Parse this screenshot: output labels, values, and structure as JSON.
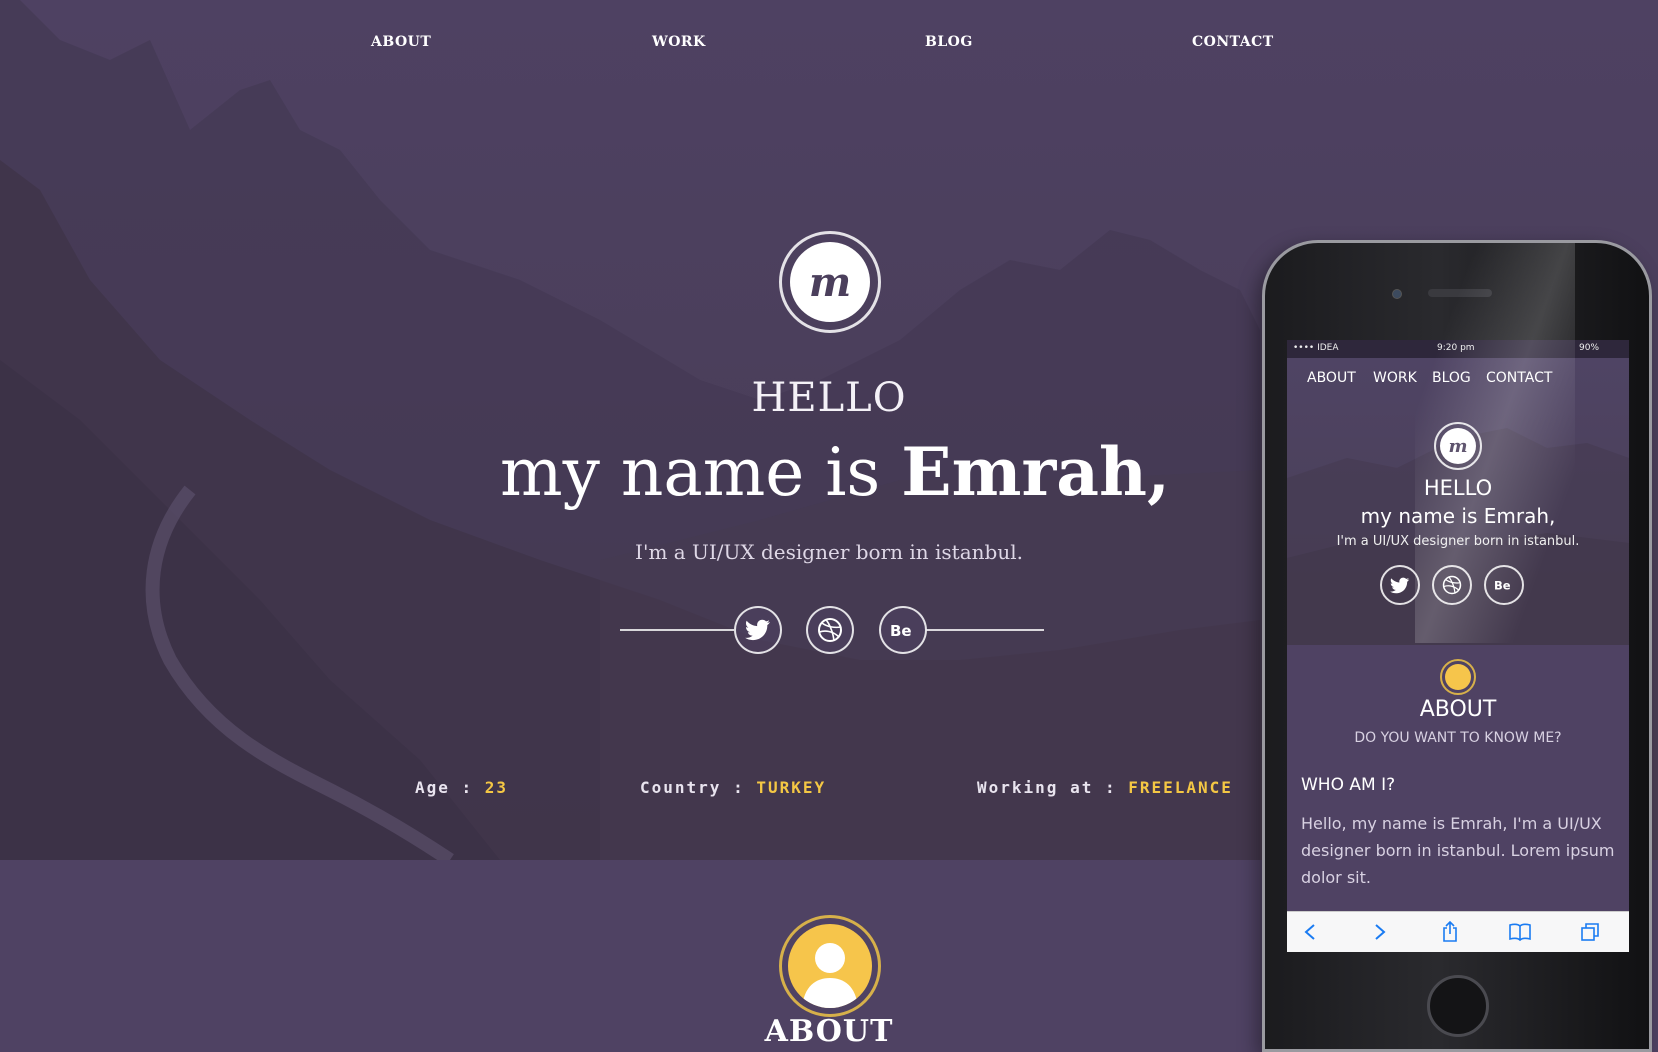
{
  "nav": {
    "items": [
      {
        "label": "ABOUT"
      },
      {
        "label": "WORK"
      },
      {
        "label": "BLOG"
      },
      {
        "label": "CONTACT"
      }
    ]
  },
  "hero": {
    "logo_letter": "m",
    "greeting": "HELLO",
    "name_prefix": "my name is ",
    "name": "Emrah,",
    "tagline": "I'm a UI/UX designer born in istanbul.",
    "social": [
      {
        "icon": "twitter-icon"
      },
      {
        "icon": "dribbble-icon"
      },
      {
        "icon": "behance-icon"
      }
    ],
    "facts": [
      {
        "label": "Age : ",
        "value": "23"
      },
      {
        "label": "Country : ",
        "value": "TURKEY"
      },
      {
        "label": "Working at : ",
        "value": "FREELANCE"
      }
    ]
  },
  "about": {
    "title": "ABOUT",
    "icon": "user-avatar-icon"
  },
  "mobile": {
    "status": {
      "carrier": "•••• IDEA",
      "time": "9:20 pm",
      "battery": "90%"
    },
    "nav": [
      {
        "label": "ABOUT"
      },
      {
        "label": "WORK"
      },
      {
        "label": "BLOG"
      },
      {
        "label": "CONTACT"
      }
    ],
    "logo_letter": "m",
    "greeting": "HELLO",
    "name_line": "my name is Emrah,",
    "tagline": "I'm a UI/UX designer born in istanbul.",
    "about_title": "ABOUT",
    "about_subtitle": "DO YOU WANT TO KNOW ME?",
    "who_title": "WHO AM I?",
    "body": "Hello, my name is Emrah, I'm a UI/UX designer born in istanbul. Lorem ipsum dolor sit."
  },
  "colors": {
    "background": "#4f4263",
    "accent": "#f4c744",
    "avatar": "#f6c54b",
    "toolbar_icon": "#1a7bf2"
  }
}
